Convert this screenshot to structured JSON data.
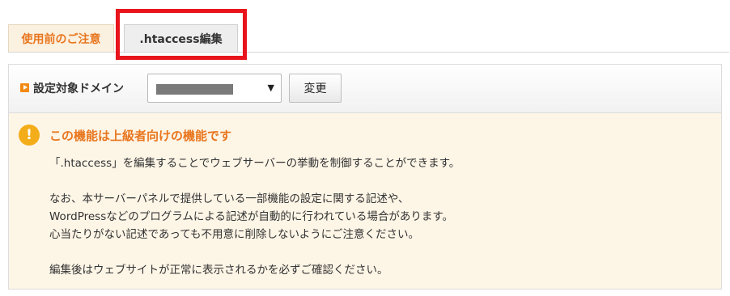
{
  "tabs": [
    {
      "label": "使用前のご注意"
    },
    {
      "label": ".htaccess編集"
    }
  ],
  "domain": {
    "label": "設定対象ドメイン",
    "caret": "▼",
    "change_button": "変更"
  },
  "notice": {
    "title": "この機能は上級者向けの機能です",
    "icon_glyph": "!",
    "lines": [
      "「.htaccess」を編集することでウェブサーバーの挙動を制御することができます。",
      "なお、本サーバーパネルで提供している一部機能の設定に関する記述や、",
      "WordPressなどのプログラムによる記述が自動的に行われている場合があります。",
      "心当たりがない記述であっても不用意に削除しないようにご注意ください。",
      "編集後はウェブサイトが正常に表示されるかを必ずご確認ください。"
    ]
  },
  "colors": {
    "accent_orange": "#e8761e",
    "highlight_red": "#e8151c",
    "notice_bg": "#fdf5e6"
  }
}
